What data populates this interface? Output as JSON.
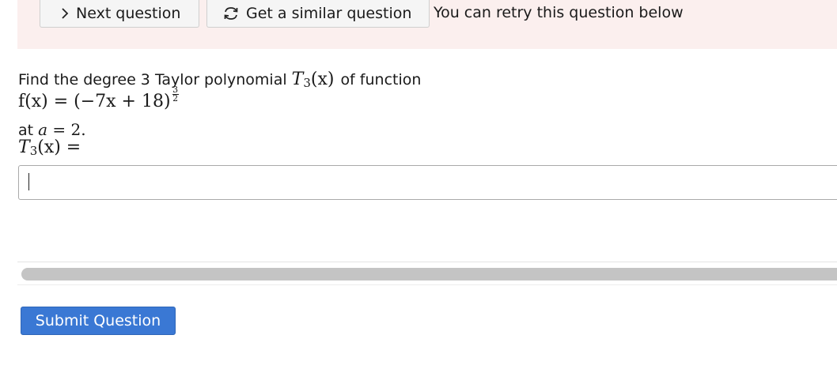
{
  "banner": {
    "next_button": {
      "label": "Next question",
      "icon": "chevron-right-icon"
    },
    "similar_button": {
      "label": "Get a similar question",
      "icon": "refresh-icon"
    },
    "retry_text": "You can retry this question below"
  },
  "question": {
    "intro": "Find the degree 3 Taylor polynomial",
    "poly_name": "T",
    "poly_sub": "3",
    "poly_arg": "(x)",
    "intro_suffix": "of function",
    "function_lhs": "f(x) = (−7x + 18)",
    "exponent_num": "3",
    "exponent_den": "2",
    "at_prefix": "at",
    "at_var": "a",
    "at_value": "= 2.",
    "answer_label_suffix": "(x) ="
  },
  "answer": {
    "value": ""
  },
  "progress": {
    "fraction": 1.0
  },
  "submit": {
    "label": "Submit Question"
  },
  "colors": {
    "banner_bg": "#fbefee",
    "submit_bg": "#3a78d4"
  }
}
